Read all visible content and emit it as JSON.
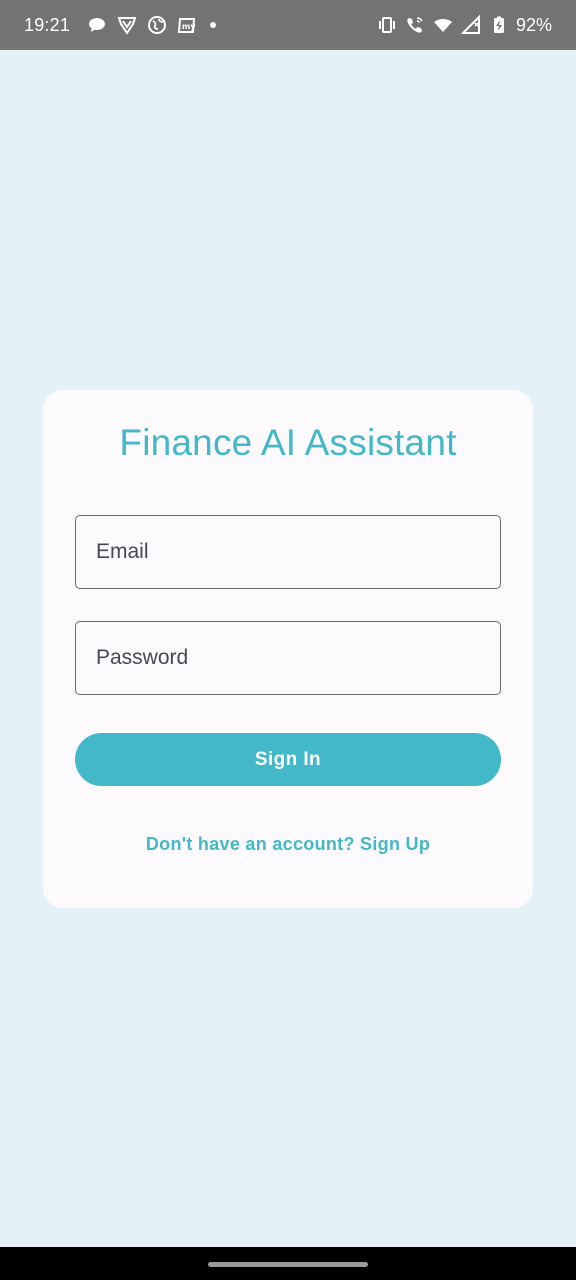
{
  "status_bar": {
    "time": "19:21",
    "left_icons": [
      "chat-bubble-icon",
      "shield-v-icon",
      "globe-icon",
      "app-my-icon",
      "dot-icon"
    ],
    "right_icons": [
      "vibrate-icon",
      "wifi-call-icon",
      "wifi-icon",
      "signal-icon",
      "battery-charging-icon"
    ],
    "battery": "92%"
  },
  "login": {
    "title": "Finance AI Assistant",
    "email_placeholder": "Email",
    "password_placeholder": "Password",
    "sign_in_label": "Sign In",
    "signup_text": "Don't have an account? Sign Up"
  },
  "colors": {
    "accent": "#43b8c8",
    "background": "#e4f2f7",
    "card": "#fcfafd",
    "status_bar": "#737373"
  }
}
